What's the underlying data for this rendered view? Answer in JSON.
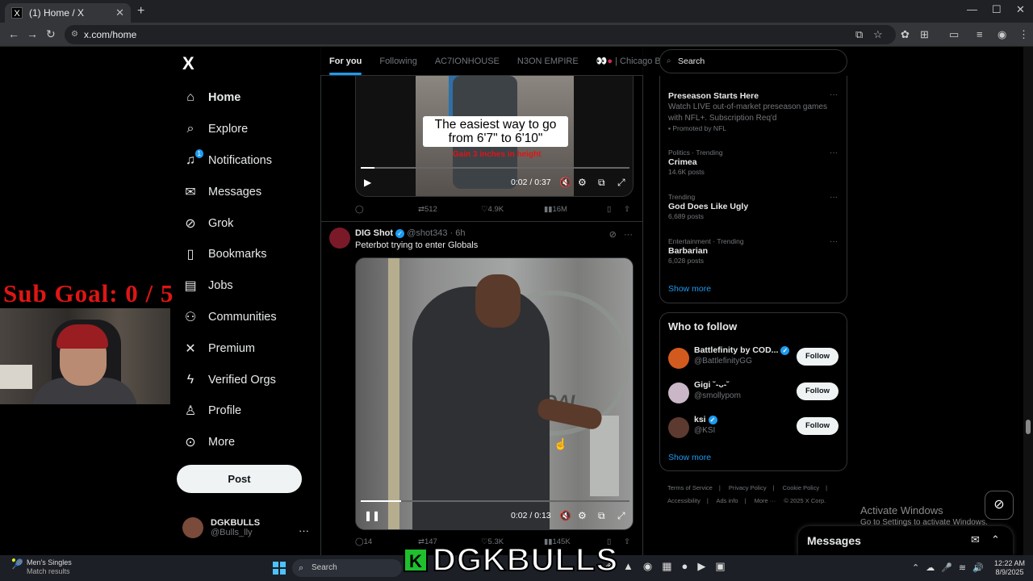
{
  "browser": {
    "tab_title": "(1) Home / X",
    "url": "x.com/home"
  },
  "sidebar": {
    "logo": "X",
    "items": [
      {
        "label": "Home",
        "icon": "home-icon"
      },
      {
        "label": "Explore",
        "icon": "search-icon"
      },
      {
        "label": "Notifications",
        "icon": "bell-icon",
        "badge": "1"
      },
      {
        "label": "Messages",
        "icon": "envelope-icon"
      },
      {
        "label": "Grok",
        "icon": "grok-icon"
      },
      {
        "label": "Bookmarks",
        "icon": "bookmark-icon"
      },
      {
        "label": "Jobs",
        "icon": "briefcase-icon"
      },
      {
        "label": "Communities",
        "icon": "people-icon"
      },
      {
        "label": "Premium",
        "icon": "x-icon"
      },
      {
        "label": "Verified Orgs",
        "icon": "lightning-icon"
      },
      {
        "label": "Profile",
        "icon": "person-icon"
      },
      {
        "label": "More",
        "icon": "more-circle-icon"
      }
    ],
    "post_label": "Post",
    "account": {
      "name": "DGKBULLS",
      "handle": "@Bulls_lly"
    }
  },
  "overlay": {
    "goal_text": "Sub Goal:  0 / 5",
    "brand_text": "DGKBULLS",
    "brand_letter": "K"
  },
  "timeline": {
    "tabs": [
      "For you",
      "Following",
      "AC7IONHOUSE",
      "N3ON EMPIRE",
      "| Chicago Bu"
    ],
    "tweet1": {
      "caption": "The easiest way to go from 6'7\" to 6'10\"",
      "caption_sub": "Gain 3 inches in height",
      "time": "0:02 / 0:37",
      "progress": 0.05,
      "reposts": "512",
      "likes": "4.9K",
      "views": "16M"
    },
    "tweet2": {
      "name": "DIG Shot",
      "handle": "@shot343",
      "age": "6h",
      "text": "Peterbot trying to enter Globals",
      "video_text": "GOAL",
      "time": "0:02 / 0:13",
      "progress": 0.15,
      "replies": "14",
      "reposts": "147",
      "likes": "5.3K",
      "views": "145K"
    }
  },
  "right": {
    "search_placeholder": "Search",
    "promo": {
      "title": "Preseason Starts Here",
      "body": "Watch LIVE out-of-market preseason games with NFL+. Subscription Req'd",
      "promoted": "Promoted by NFL"
    },
    "trends": [
      {
        "meta": "Politics · Trending",
        "title": "Crimea",
        "posts": "14.6K posts"
      },
      {
        "meta": "Trending",
        "title": "God Does Like Ugly",
        "posts": "6,689 posts"
      },
      {
        "meta": "Entertainment · Trending",
        "title": "Barbarian",
        "posts": "6,028 posts"
      }
    ],
    "show_more": "Show more",
    "who_to_follow": "Who to follow",
    "follow": [
      {
        "name": "Battlefinity by COD...",
        "handle": "@BattlefinityGG",
        "btn": "Follow",
        "color": "#d35a1f"
      },
      {
        "name": "Gigi ˘-ᴗ-˘",
        "handle": "@smollypom",
        "btn": "Follow",
        "color": "#c9b7c7"
      },
      {
        "name": "ksi",
        "handle": "@KSI",
        "btn": "Follow",
        "color": "#5c3a30"
      }
    ],
    "footer": [
      "Terms of Service",
      "|",
      "Privacy Policy",
      "|",
      "Cookie Policy",
      "|",
      "Accessibility",
      "|",
      "Ads info",
      "|",
      "More ···",
      "© 2025 X Corp."
    ],
    "messages_drawer": "Messages"
  },
  "system": {
    "activate_title": "Activate Windows",
    "activate_sub": "Go to Settings to activate Windows.",
    "weather_title": "Men's Singles",
    "weather_sub": "Match results",
    "taskbar_search": "Search",
    "time": "12:22 AM",
    "date": "8/9/2025"
  }
}
